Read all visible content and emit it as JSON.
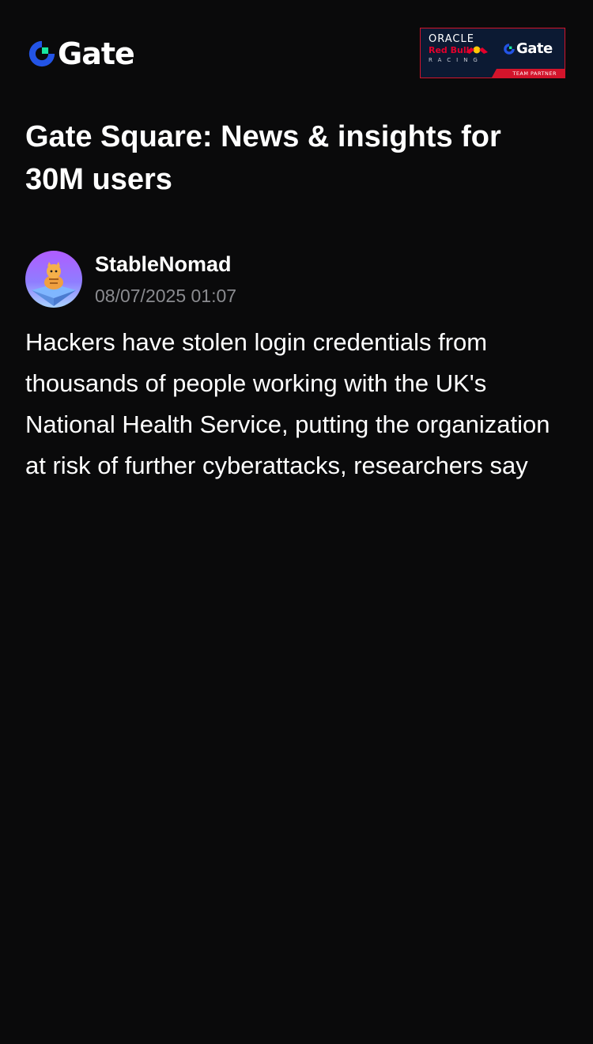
{
  "header": {
    "logo_text": "Gate",
    "partner_badge": {
      "line1": "ORACLE",
      "line2": "Red Bull",
      "line3": "RACING",
      "brand": "Gate",
      "tag": "TEAM PARTNER"
    }
  },
  "page": {
    "title": "Gate Square: News & insights for 30M users"
  },
  "post": {
    "author": "StableNomad",
    "timestamp": "08/07/2025 01:07",
    "body": "Hackers have stolen login credentials from thousands of people working with the UK's National Health Service, putting the organization at risk of further cyberattacks, researchers say"
  },
  "colors": {
    "background": "#0a0a0b",
    "brand_blue": "#2354e6",
    "brand_green": "#17e6a1",
    "muted_text": "#8a8b8f",
    "badge_red": "#d3142b",
    "badge_navy": "#0c1a33"
  },
  "icons": {
    "logo": "gate-logo-icon",
    "bull": "red-bull-icon",
    "avatar": "user-avatar"
  }
}
